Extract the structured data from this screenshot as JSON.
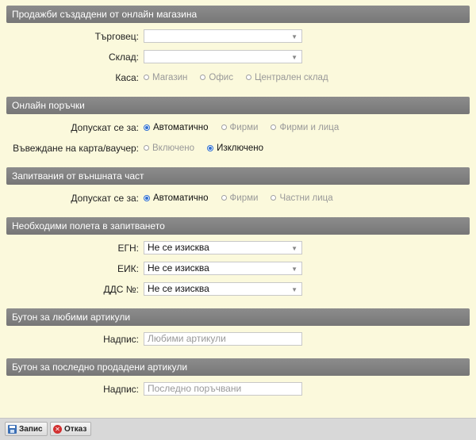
{
  "sections": {
    "s1": {
      "title": "Продажби създадени от онлайн магазина",
      "merchant_label": "Търговец:",
      "merchant_value": "",
      "warehouse_label": "Склад:",
      "warehouse_value": "",
      "cash_label": "Каса:",
      "cash_options": [
        "Магазин",
        "Офис",
        "Централен склад"
      ]
    },
    "s2": {
      "title": "Онлайн поръчки",
      "allowed_label": "Допускат се за:",
      "allowed_options": [
        "Автоматично",
        "Фирми",
        "Фирми и лица"
      ],
      "card_label": "Въвеждане на карта/ваучер:",
      "card_options": [
        "Включено",
        "Изключено"
      ]
    },
    "s3": {
      "title": "Запитвания от външната част",
      "allowed_label": "Допускат се за:",
      "allowed_options": [
        "Автоматично",
        "Фирми",
        "Частни лица"
      ]
    },
    "s4": {
      "title": "Необходими полета в запитването",
      "egn_label": "ЕГН:",
      "egn_value": "Не се изисква",
      "eik_label": "ЕИК:",
      "eik_value": "Не се изисква",
      "vat_label": "ДДС №:",
      "vat_value": "Не се изисква"
    },
    "s5": {
      "title": "Бутон за любими артикули",
      "caption_label": "Надпис:",
      "caption_placeholder": "Любими артикули"
    },
    "s6": {
      "title": "Бутон за последно продадени артикули",
      "caption_label": "Надпис:",
      "caption_placeholder": "Последно поръчвани"
    }
  },
  "footer": {
    "save_label": "Запис",
    "cancel_label": "Отказ"
  }
}
